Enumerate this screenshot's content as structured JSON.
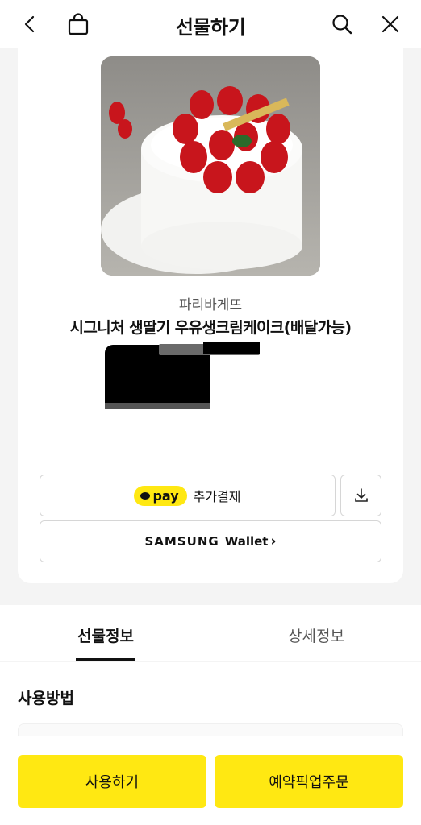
{
  "header": {
    "title": "선물하기",
    "icons": [
      "back-icon",
      "shopping-bag-icon",
      "search-icon",
      "close-icon"
    ]
  },
  "product": {
    "brand": "파리바게뜨",
    "name": "시그니처 생딸기 우유생크림케이크(배달가능)"
  },
  "payment": {
    "kakaopay_badge": "pay",
    "kakaopay_label": "추가결제",
    "download_icon": "download-icon",
    "samsung_brand": "SAMSUNG",
    "samsung_product": "Wallet",
    "samsung_arrow": "›"
  },
  "tabs": [
    {
      "label": "선물정보",
      "active": true
    },
    {
      "label": "상세정보",
      "active": false
    }
  ],
  "usage": {
    "title": "사용방법"
  },
  "bottom_actions": {
    "use_label": "사용하기",
    "pickup_label": "예약픽업주문"
  },
  "colors": {
    "accent_yellow": "#ffe812",
    "text": "#111111",
    "background": "#f4f4f4"
  }
}
